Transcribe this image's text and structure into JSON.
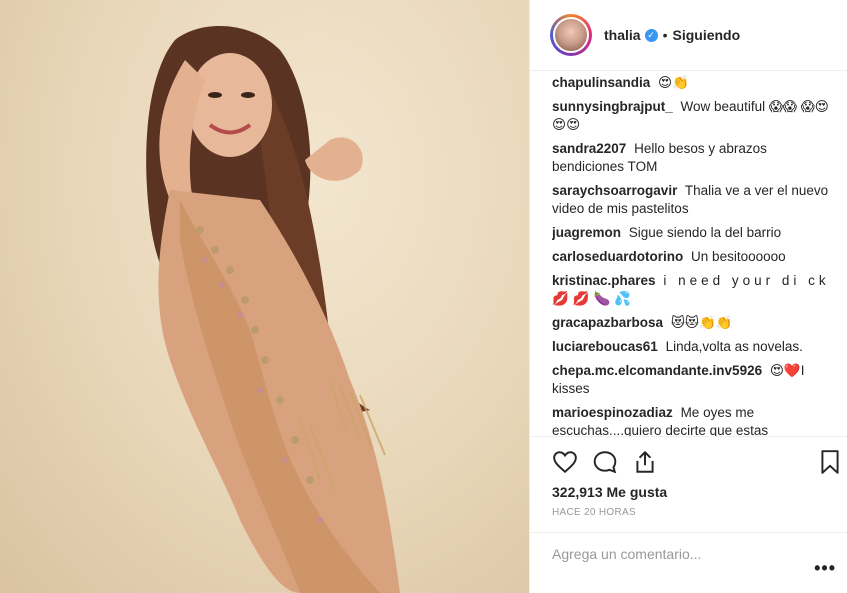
{
  "post": {
    "username": "thalia",
    "separator": "•",
    "follow_label": "Siguiendo",
    "likes": "322,913 Me gusta",
    "time": "HACE 20 HORAS",
    "comment_placeholder": "Agrega un comentario...",
    "more_label": "•••"
  },
  "comments": [
    {
      "user": "chapulinsandia",
      "text": "😍👏"
    },
    {
      "user": "sunnysingbrajput_",
      "text": "Wow beautiful 😱😱 😱😍😍😍"
    },
    {
      "user": "sandra2207",
      "text": "Hello besos y abrazos bendiciones TOM"
    },
    {
      "user": "saraychsoarrogavir",
      "text": "Thalia ve a ver el nuevo video de mis pastelitos"
    },
    {
      "user": "juagremon",
      "text": "Sigue siendo la del barrio"
    },
    {
      "user": "carloseduardotorino",
      "text": "Un besitoooooo"
    },
    {
      "user": "kristinac.phares",
      "text": "i need your di ck💋💋🍆💦"
    },
    {
      "user": "gracapazbarbosa",
      "text": "😻😻👏👏"
    },
    {
      "user": "luciareboucas61",
      "text": "Linda,volta as novelas."
    },
    {
      "user": "chepa.mc.elcomandante.inv5926",
      "text": "😍❤️I kisses"
    },
    {
      "user": "marioespinozadiaz",
      "text": "Me oyes me escuchas....quiero decirte que estas"
    }
  ],
  "colors": {
    "accent_blue": "#3897f0",
    "text": "#262626",
    "muted": "#999999",
    "border": "#efefef"
  },
  "icons": [
    "heart-icon",
    "comment-icon",
    "share-icon",
    "bookmark-icon",
    "verified-badge-icon"
  ]
}
